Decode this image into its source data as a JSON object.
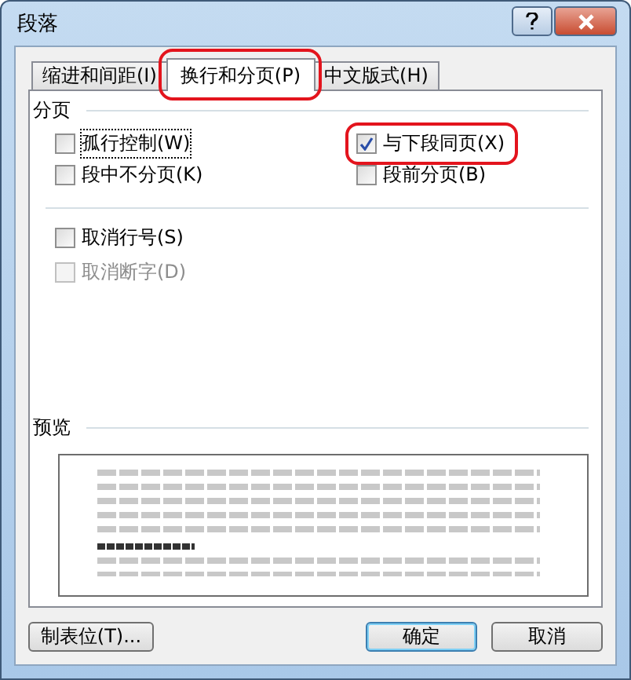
{
  "window": {
    "title": "段落"
  },
  "tabs": [
    {
      "label": "缩进和间距(I)",
      "selected": false,
      "highlighted": false
    },
    {
      "label": "换行和分页(P)",
      "selected": true,
      "highlighted": true
    },
    {
      "label": "中文版式(H)",
      "selected": false,
      "highlighted": false
    }
  ],
  "pagination": {
    "heading": "分页",
    "options": [
      {
        "label": "孤行控制(W)",
        "checked": false,
        "disabled": false,
        "focused": true,
        "highlighted": false
      },
      {
        "label": "与下段同页(X)",
        "checked": true,
        "disabled": false,
        "focused": false,
        "highlighted": true
      },
      {
        "label": "段中不分页(K)",
        "checked": false,
        "disabled": false,
        "focused": false,
        "highlighted": false
      },
      {
        "label": "段前分页(B)",
        "checked": false,
        "disabled": false,
        "focused": false,
        "highlighted": false
      }
    ]
  },
  "other_options": [
    {
      "label": "取消行号(S)",
      "checked": false,
      "disabled": false
    },
    {
      "label": "取消断字(D)",
      "checked": false,
      "disabled": true
    }
  ],
  "preview": {
    "heading": "预览"
  },
  "buttons": [
    {
      "label": "制表位(T)...",
      "kind": "left",
      "default": false
    },
    {
      "label": "确定",
      "kind": "right",
      "default": true
    },
    {
      "label": "取消",
      "kind": "right",
      "default": false
    }
  ]
}
